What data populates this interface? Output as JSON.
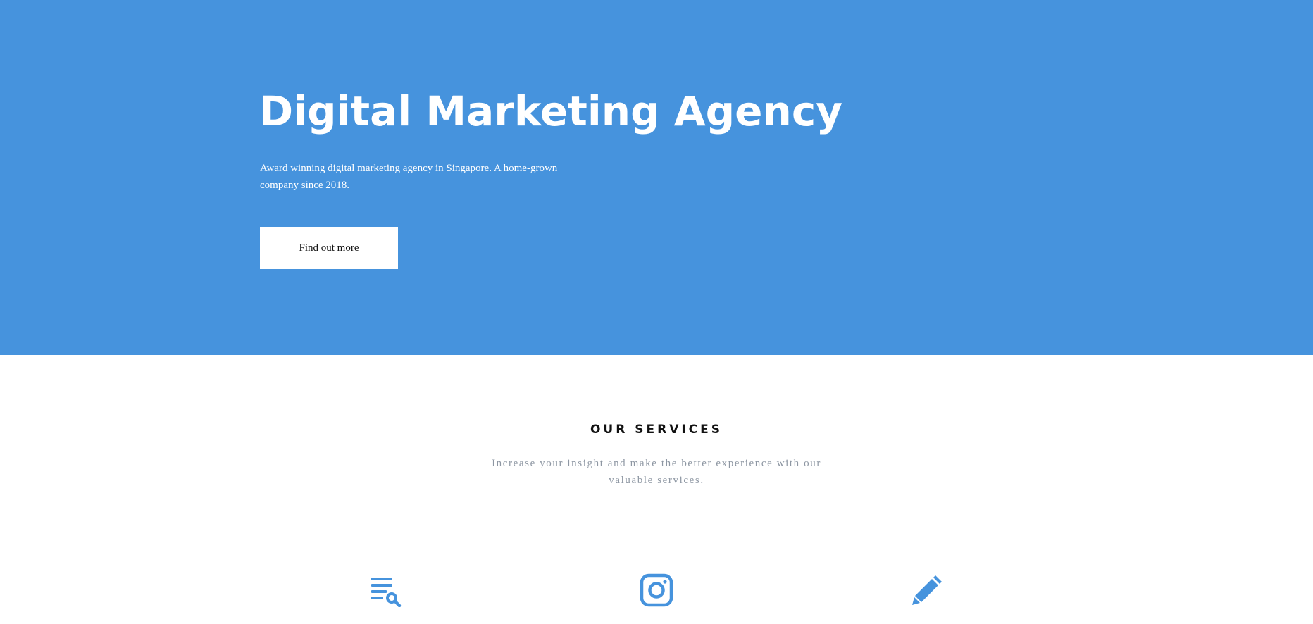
{
  "hero": {
    "title": "Digital Marketing Agency",
    "subtitle": "Award winning digital marketing agency in Singapore. A home-grown company since 2018.",
    "cta_label": "Find out more",
    "background_color": "#4693dd"
  },
  "services": {
    "heading": "OUR SERVICES",
    "subtitle": "Increase your insight and make the better experience with our valuable services.",
    "icons": [
      "search-list-icon",
      "instagram-icon",
      "pencil-icon"
    ],
    "accent_color": "#4693dd"
  }
}
